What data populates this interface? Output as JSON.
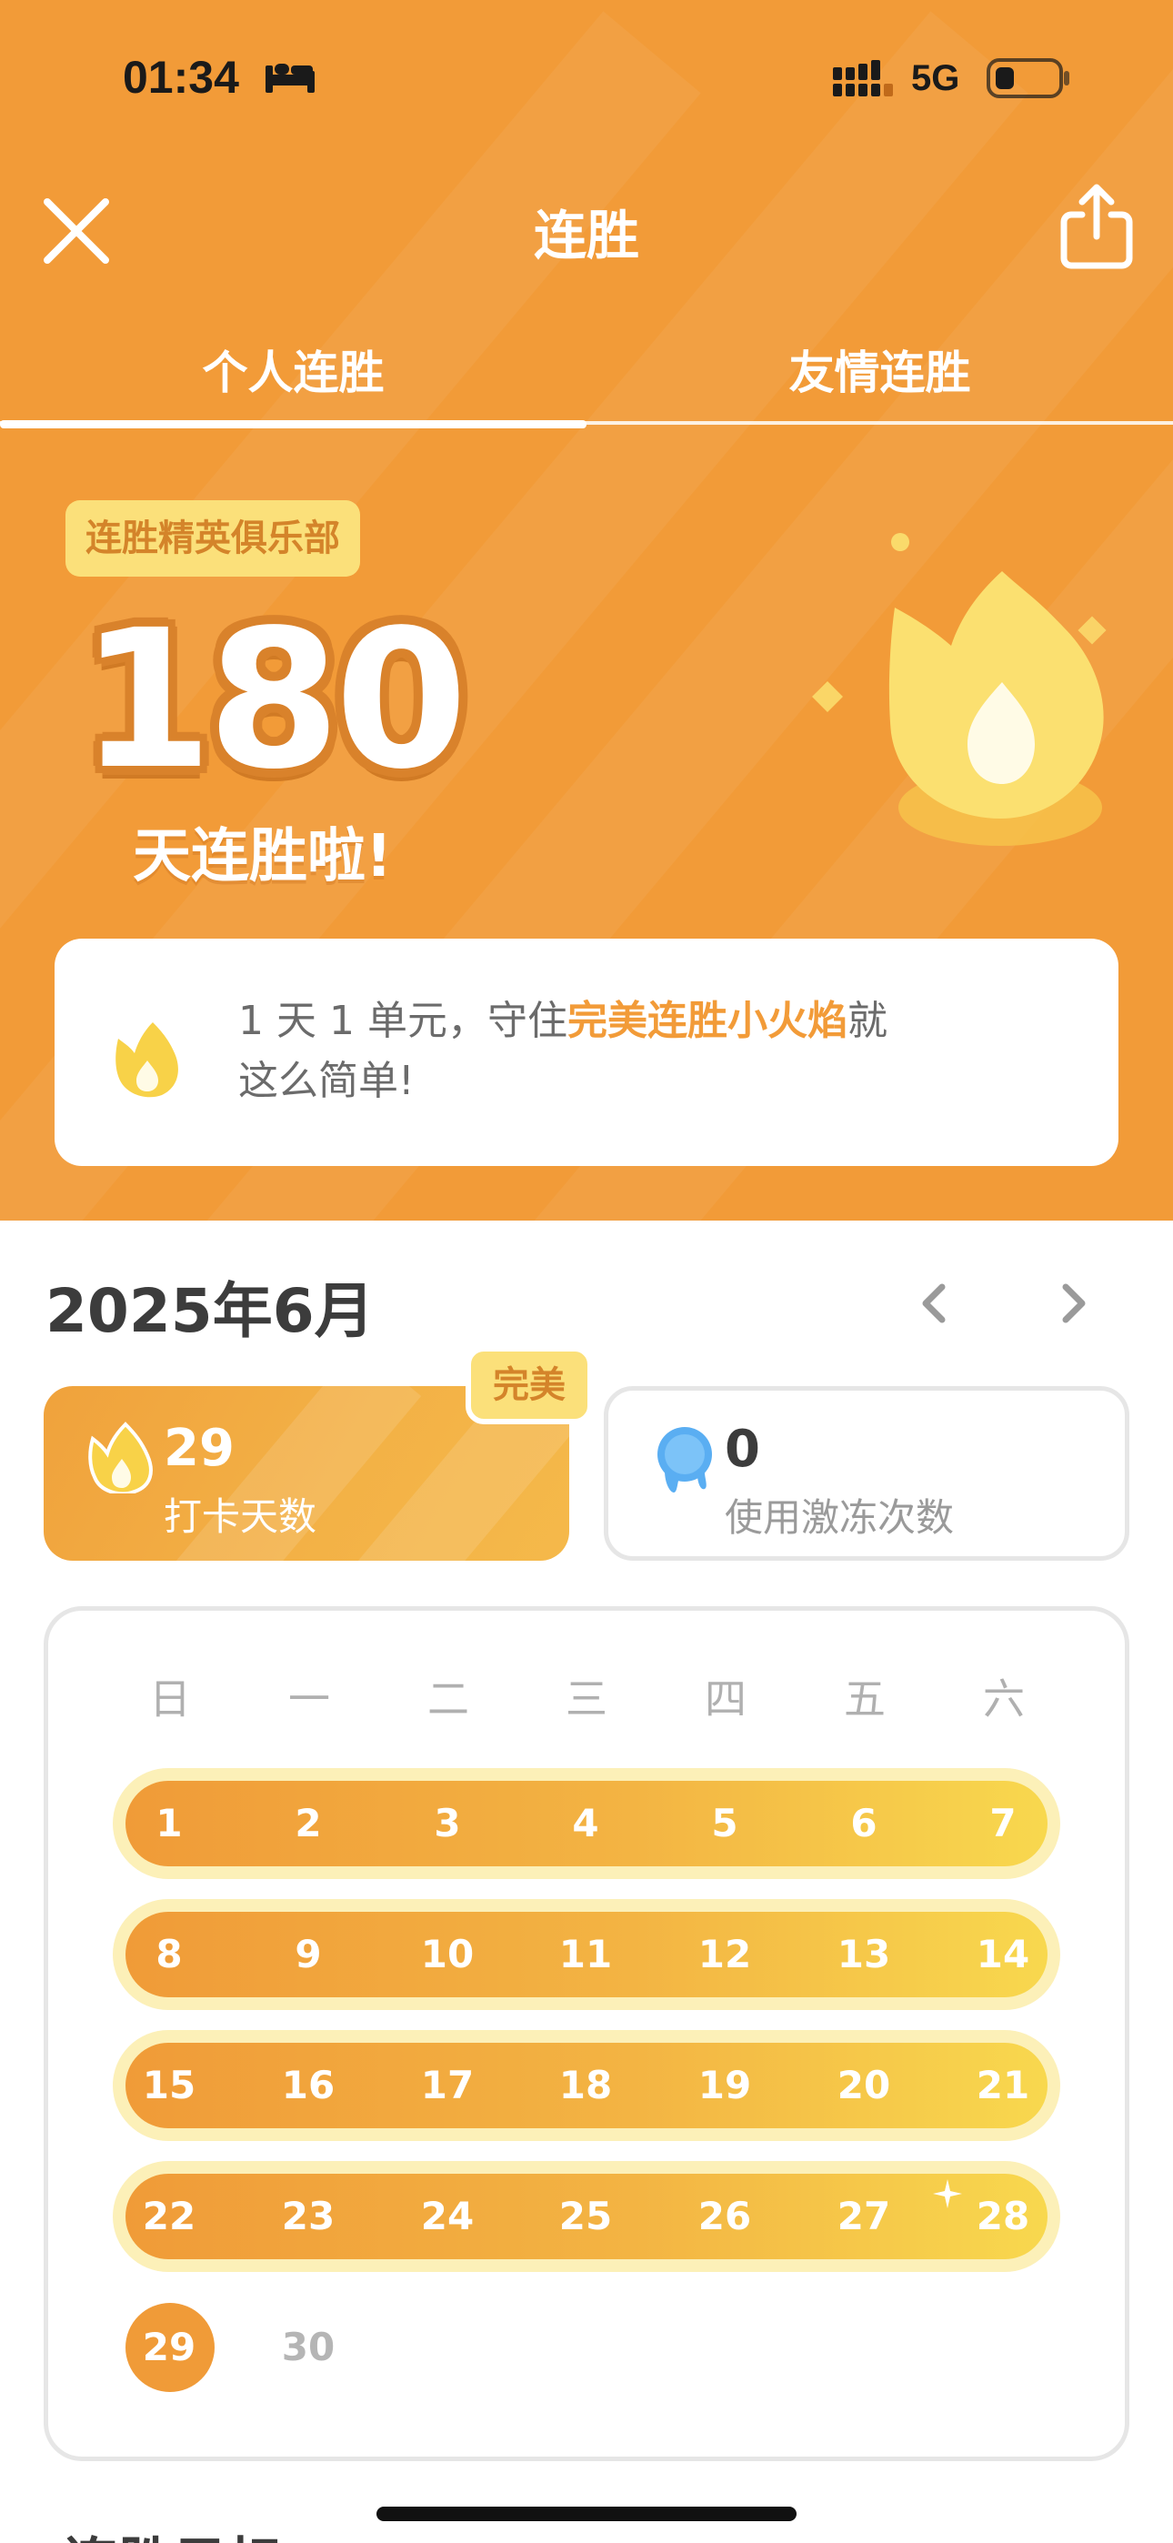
{
  "status_bar": {
    "time": "01:34",
    "network": "5G",
    "icons": [
      "sleep-focus-icon",
      "signal-icon",
      "battery-icon"
    ]
  },
  "nav": {
    "title": "连胜",
    "close_icon": "close-icon",
    "share_icon": "share-icon"
  },
  "tabs": [
    {
      "label": "个人连胜",
      "selected": true
    },
    {
      "label": "友情连胜",
      "selected": false
    }
  ],
  "hero": {
    "club_badge": "连胜精英俱乐部",
    "streak_days": "180",
    "caption": "天连胜啦!"
  },
  "tip": {
    "prefix": "1 天 1 单元，守住",
    "highlight": "完美连胜小火焰",
    "suffix_line1": "就",
    "line2": "这么简单!"
  },
  "month": {
    "title": "2025年6月",
    "prev_icon": "chevron-left-icon",
    "next_icon": "chevron-right-icon"
  },
  "stats": {
    "perfect_tag": "完美",
    "checkin_value": "29",
    "checkin_label": "打卡天数",
    "freeze_value": "0",
    "freeze_label": "使用激冻次数"
  },
  "calendar": {
    "weekdays": [
      "日",
      "一",
      "二",
      "三",
      "四",
      "五",
      "六"
    ],
    "weeks": [
      [
        "1",
        "2",
        "3",
        "4",
        "5",
        "6",
        "7"
      ],
      [
        "8",
        "9",
        "10",
        "11",
        "12",
        "13",
        "14"
      ],
      [
        "15",
        "16",
        "17",
        "18",
        "19",
        "20",
        "21"
      ],
      [
        "22",
        "23",
        "24",
        "25",
        "26",
        "27",
        "28"
      ]
    ],
    "last_row": [
      "29",
      "30"
    ],
    "today": "29"
  },
  "next_section_peek": "连胜目标",
  "colors": {
    "brand_orange": "#f29b38",
    "badge_yellow": "#fbe07a",
    "text_dark": "#3c3c3c",
    "text_muted": "#9a9a9a"
  }
}
